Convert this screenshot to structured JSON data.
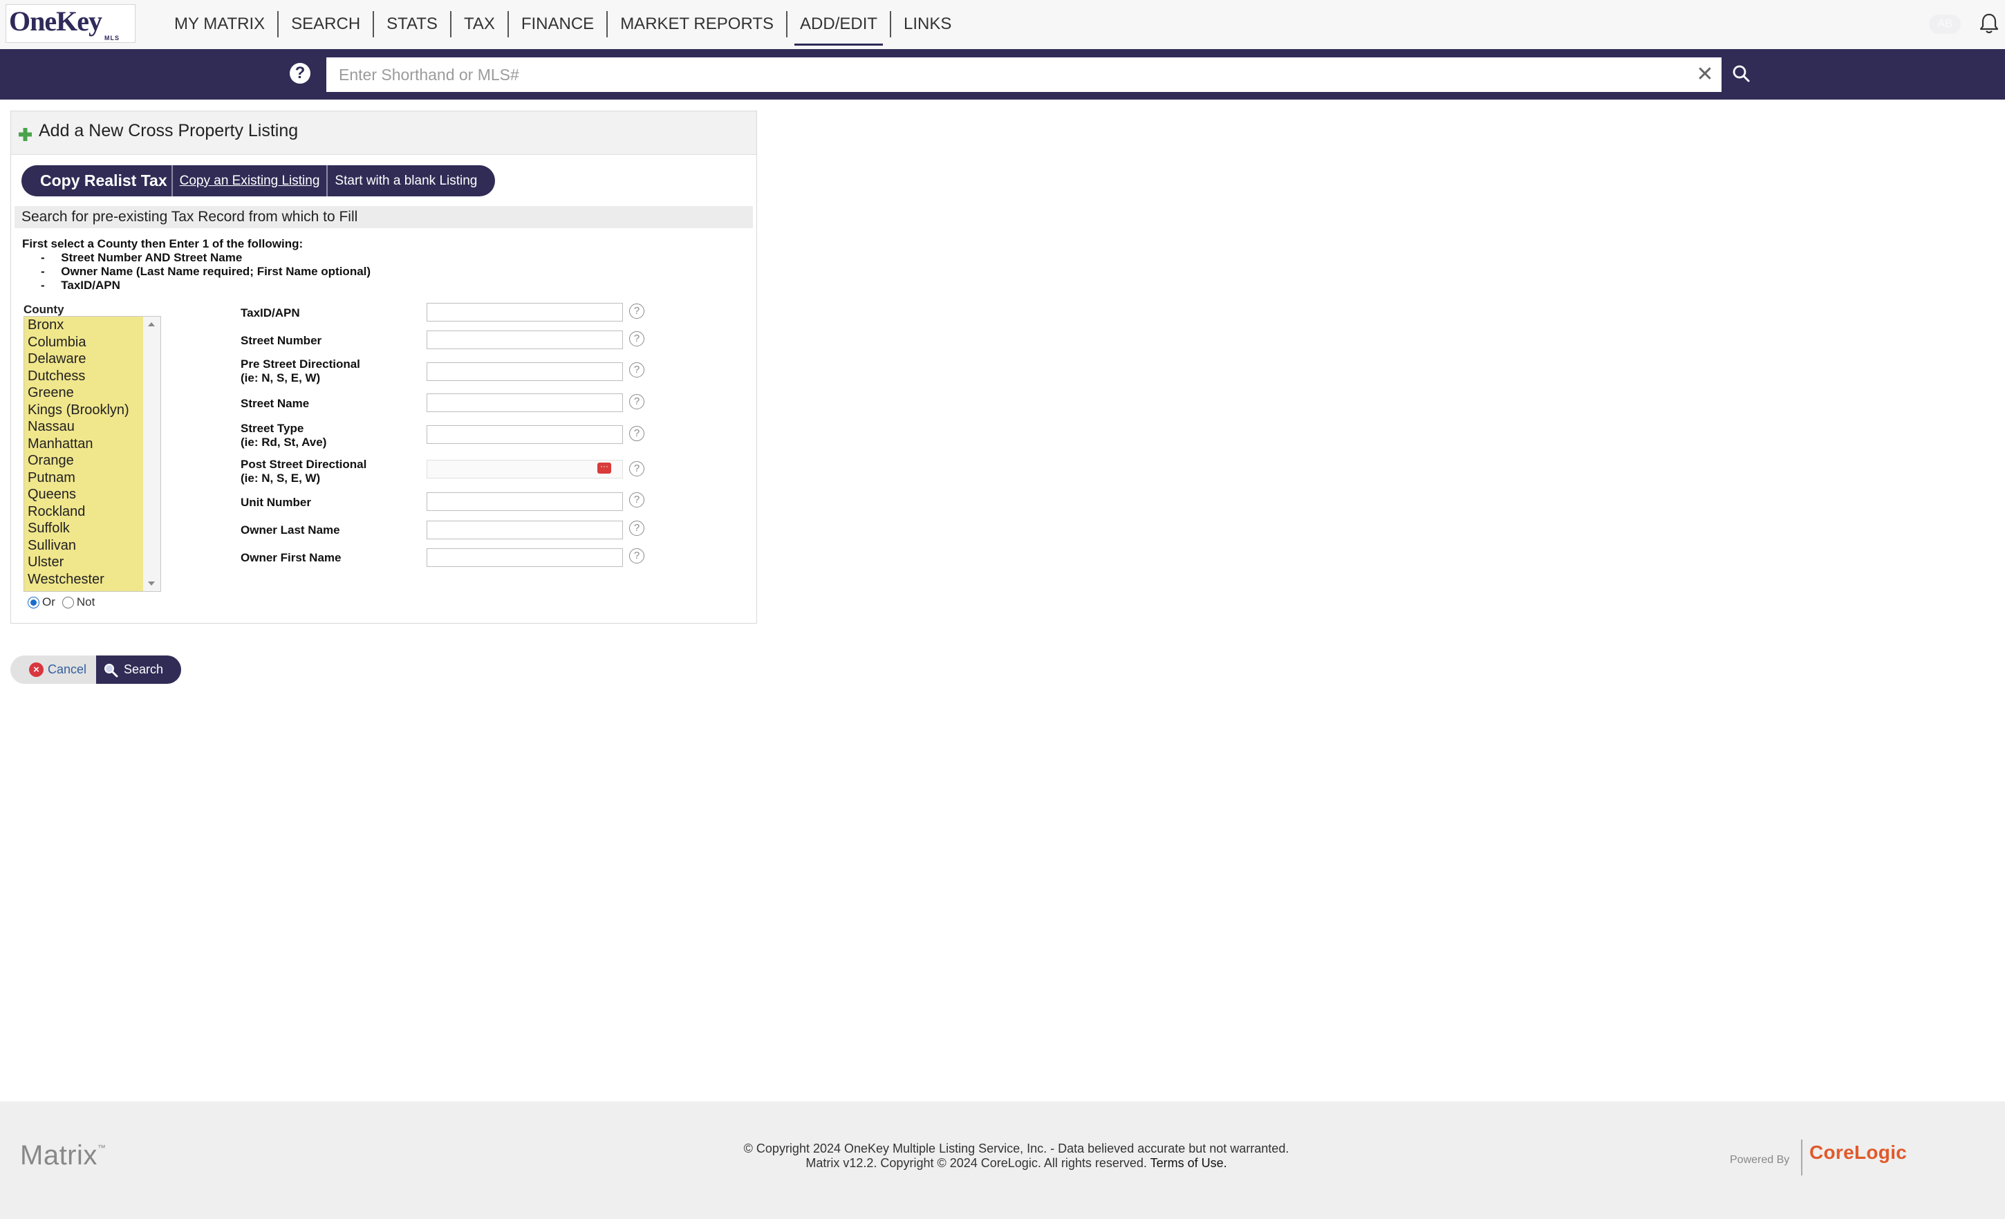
{
  "brand": {
    "logo_text": "OneKey",
    "logo_sub": "MLS"
  },
  "nav": {
    "items": [
      {
        "label": "MY MATRIX"
      },
      {
        "label": "SEARCH"
      },
      {
        "label": "STATS"
      },
      {
        "label": "TAX"
      },
      {
        "label": "FINANCE"
      },
      {
        "label": "MARKET REPORTS"
      },
      {
        "label": "ADD/EDIT",
        "active": true
      },
      {
        "label": "LINKS"
      }
    ],
    "user_initials": "AB"
  },
  "search": {
    "placeholder": "Enter Shorthand or MLS#",
    "value": "",
    "help_label": "?",
    "clear_label": "✕"
  },
  "panel": {
    "title": "Add a New Cross Property Listing",
    "tabs": [
      {
        "label": "Copy Realist Tax",
        "active": true
      },
      {
        "label": "Copy an Existing Listing"
      },
      {
        "label": "Start with a blank Listing"
      }
    ],
    "section_title": "Search for pre-existing Tax Record from which to Fill",
    "instructions": {
      "intro": "First select a County then Enter 1 of the following:",
      "items": [
        "-     Street Number AND Street Name",
        "-     Owner Name (Last Name required; First Name optional)",
        "-     TaxID/APN"
      ]
    },
    "county": {
      "label": "County",
      "options": [
        "Bronx",
        "Columbia",
        "Delaware",
        "Dutchess",
        "Greene",
        "Kings (Brooklyn)",
        "Nassau",
        "Manhattan",
        "Orange",
        "Putnam",
        "Queens",
        "Rockland",
        "Suffolk",
        "Sullivan",
        "Ulster",
        "Westchester"
      ],
      "mode_options": [
        {
          "label": "Or",
          "selected": true
        },
        {
          "label": "Not",
          "selected": false
        }
      ]
    },
    "fields": [
      {
        "label_line1": "TaxID/APN",
        "label_line2": "",
        "value": ""
      },
      {
        "label_line1": "Street Number",
        "label_line2": "",
        "value": ""
      },
      {
        "label_line1": "Pre Street Directional",
        "label_line2": "(ie: N, S, E, W)",
        "value": ""
      },
      {
        "label_line1": "Street Name",
        "label_line2": "",
        "value": ""
      },
      {
        "label_line1": "Street Type",
        "label_line2": "(ie: Rd, St, Ave)",
        "value": ""
      },
      {
        "label_line1": "Post Street Directional",
        "label_line2": "(ie: N, S, E, W)",
        "value": ""
      },
      {
        "label_line1": "Unit Number",
        "label_line2": "",
        "value": ""
      },
      {
        "label_line1": "Owner Last Name",
        "label_line2": "",
        "value": ""
      },
      {
        "label_line1": "Owner First Name",
        "label_line2": "",
        "value": ""
      }
    ],
    "help_glyph": "?"
  },
  "actions": {
    "cancel_label": "Cancel",
    "search_label": "Search"
  },
  "footer": {
    "matrix_logo": "Matrix",
    "matrix_tm": "™",
    "copyright_line1": "© Copyright 2024 OneKey Multiple Listing Service, Inc. - Data believed accurate but not warranted.",
    "copyright_line2": "Matrix v12.2. Copyright © 2024 CoreLogic. All rights reserved.",
    "terms_label": "Terms of Use.",
    "powered_by": "Powered By",
    "corelogic": "CoreLogic"
  },
  "colors": {
    "brand_navy": "#302c56",
    "county_highlight": "#f0e68c",
    "corelogic_orange": "#e05a2b",
    "cancel_red": "#d9363e"
  },
  "icons": [
    "plus-icon",
    "help-icon",
    "clear-icon",
    "search-icon",
    "bell-icon",
    "lookup-icon",
    "cancel-icon",
    "scroll-up-icon",
    "scroll-down-icon"
  ]
}
